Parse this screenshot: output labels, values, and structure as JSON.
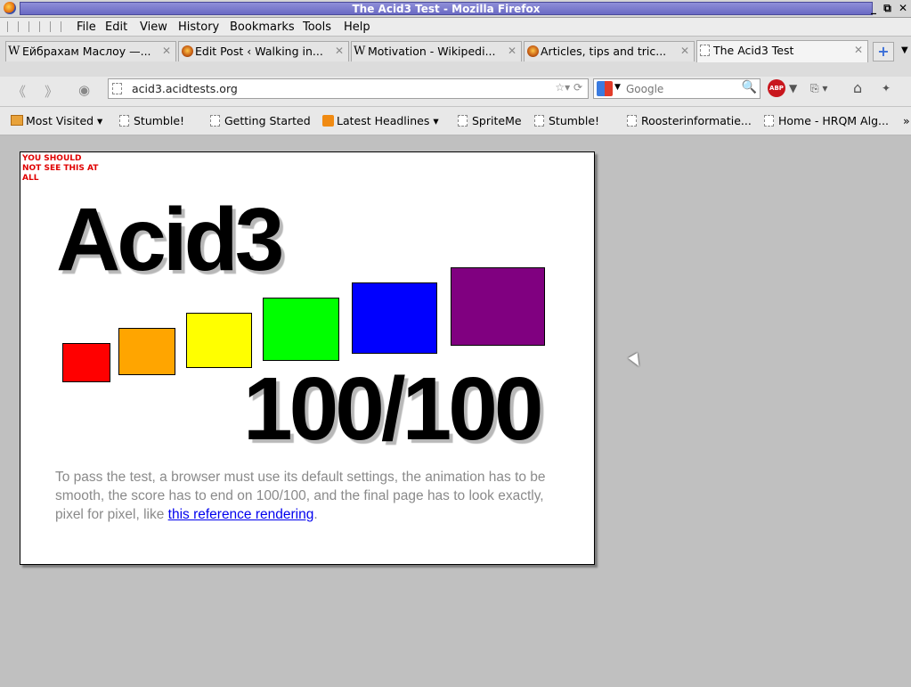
{
  "window": {
    "title": "The Acid3 Test - Mozilla Firefox",
    "controls": "_ ⧉ ✕"
  },
  "menubar": {
    "items": [
      "File",
      "Edit",
      "View",
      "History",
      "Bookmarks",
      "Tools",
      "Help"
    ]
  },
  "tabs": [
    {
      "icon": "wikipedia-icon",
      "label": "Ейбрахам Маслоу —...",
      "active": false
    },
    {
      "icon": "avatar-icon",
      "label": "Edit Post ‹ Walking in...",
      "active": false
    },
    {
      "icon": "wikipedia-icon",
      "label": "Motivation - Wikipedi...",
      "active": false
    },
    {
      "icon": "avatar-icon",
      "label": "Articles, tips and tric...",
      "active": false
    },
    {
      "icon": "blank-page-icon",
      "label": "The Acid3 Test",
      "active": true
    }
  ],
  "navbar": {
    "url_domain": "acid3.acidtests.org",
    "search_placeholder": "Google"
  },
  "bookmarks": [
    {
      "icon": "folder-icon",
      "label": "Most Visited ▾"
    },
    {
      "icon": "blank-page-icon",
      "label": "Stumble!"
    },
    {
      "icon": "blank-page-icon",
      "label": "Getting Started"
    },
    {
      "icon": "rss-icon",
      "label": "Latest Headlines ▾"
    },
    {
      "icon": "blank-page-icon",
      "label": "SpriteMe"
    },
    {
      "icon": "blank-page-icon",
      "label": "Stumble!"
    },
    {
      "icon": "blank-page-icon",
      "label": "Roosterinformatie..."
    },
    {
      "icon": "blank-page-icon",
      "label": "Home - HRQM Alg..."
    }
  ],
  "acid": {
    "warning": "YOU SHOULD NOT SEE THIS AT ALL",
    "title": "Acid3",
    "score": "100/100",
    "description": "To pass the test, a browser must use its default settings, the animation has to be smooth, the score has to end on 100/100, and the final page has to look exactly, pixel for pixel, like",
    "link_text": "this reference rendering",
    "trailing": ".",
    "buckets": [
      {
        "color": "#ff0000"
      },
      {
        "color": "#ffa500"
      },
      {
        "color": "#ffff00"
      },
      {
        "color": "#00ff00"
      },
      {
        "color": "#0000ff"
      },
      {
        "color": "#800080"
      }
    ]
  }
}
